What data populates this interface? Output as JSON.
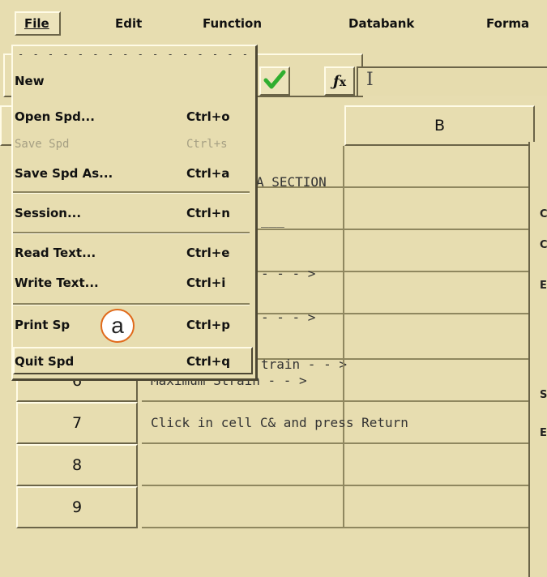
{
  "menubar": {
    "items": [
      {
        "label": "File"
      },
      {
        "label": "Edit"
      },
      {
        "label": "Function"
      },
      {
        "label": "Databank"
      },
      {
        "label": "Forma"
      }
    ]
  },
  "toolbar": {
    "accept_icon": "check-icon",
    "function_icon": "fx-icon",
    "function_label": "fx"
  },
  "grid": {
    "col_b": "B",
    "rows": [
      {
        "num": "",
        "a": "A SECTION"
      },
      {
        "num": "",
        "a": "___"
      },
      {
        "num": "",
        "a": "- - - >"
      },
      {
        "num": "",
        "a": "- - - >"
      },
      {
        "num": "",
        "a": "train - - >"
      },
      {
        "num": "6",
        "a": "Maximum Strain - - >"
      },
      {
        "num": "7",
        "a": "Click in cell C& and press Return"
      },
      {
        "num": "8",
        "a": ""
      },
      {
        "num": "9",
        "a": ""
      }
    ]
  },
  "file_menu": {
    "tear_off": "- - - - - - - - - - - - - - - - - - - - - -",
    "items": [
      {
        "label": "New",
        "shortcut": "",
        "enabled": true
      },
      {
        "label": "Open Spd...",
        "shortcut": "Ctrl+o",
        "enabled": true
      },
      {
        "label": "Save Spd",
        "shortcut": "Ctrl+s",
        "enabled": false
      },
      {
        "label": "Save Spd As...",
        "shortcut": "Ctrl+a",
        "enabled": true
      },
      {
        "label": "Session...",
        "shortcut": "Ctrl+n",
        "enabled": true
      },
      {
        "label": "Read Text...",
        "shortcut": "Ctrl+e",
        "enabled": true
      },
      {
        "label": "Write Text...",
        "shortcut": "Ctrl+i",
        "enabled": true
      },
      {
        "label": "Print Sp",
        "shortcut": "Ctrl+p",
        "enabled": true
      },
      {
        "label": "Quit Spd",
        "shortcut": "Ctrl+q",
        "enabled": true
      }
    ]
  },
  "callout": {
    "label": "a"
  },
  "right_panel": {
    "letters": [
      "C",
      "C",
      "E",
      "S",
      "E"
    ]
  },
  "colors": {
    "background": "#e7ddb0",
    "highlight": "#fffbe6",
    "shadow": "#6b6448",
    "callout_border": "#e06a1b",
    "check": "#2fae2f"
  }
}
